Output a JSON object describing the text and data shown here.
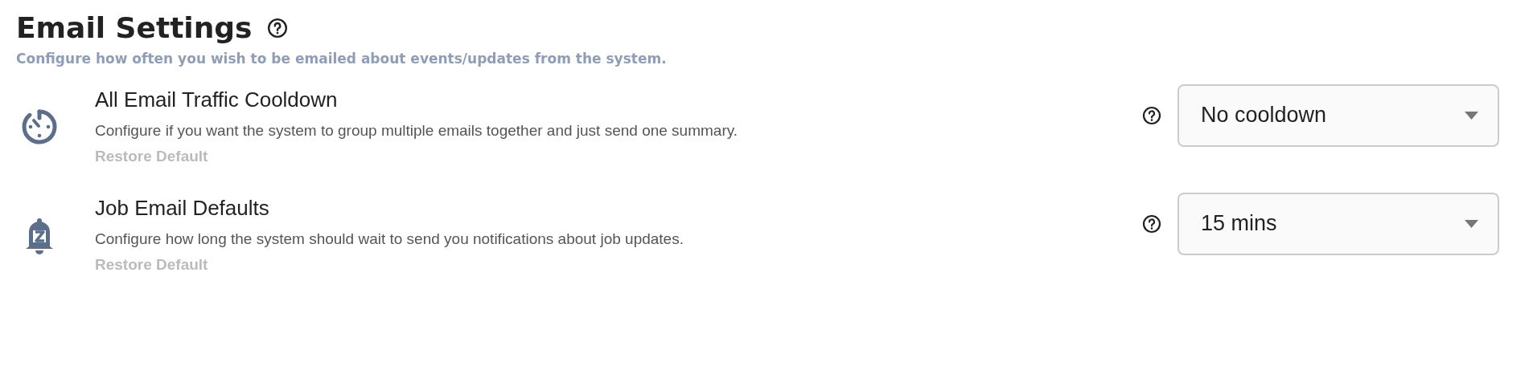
{
  "header": {
    "title": "Email Settings",
    "subtitle": "Configure how often you wish to be emailed about events/updates from the system."
  },
  "settings": [
    {
      "kind": "cooldown",
      "title": "All Email Traffic Cooldown",
      "description": "Configure if you want the system to group multiple emails together and just send one summary.",
      "restore": "Restore Default",
      "value": "No cooldown"
    },
    {
      "kind": "bell",
      "title": "Job Email Defaults",
      "description": "Configure how long the system should wait to send you notifications about job updates.",
      "restore": "Restore Default",
      "value": "15 mins"
    }
  ]
}
